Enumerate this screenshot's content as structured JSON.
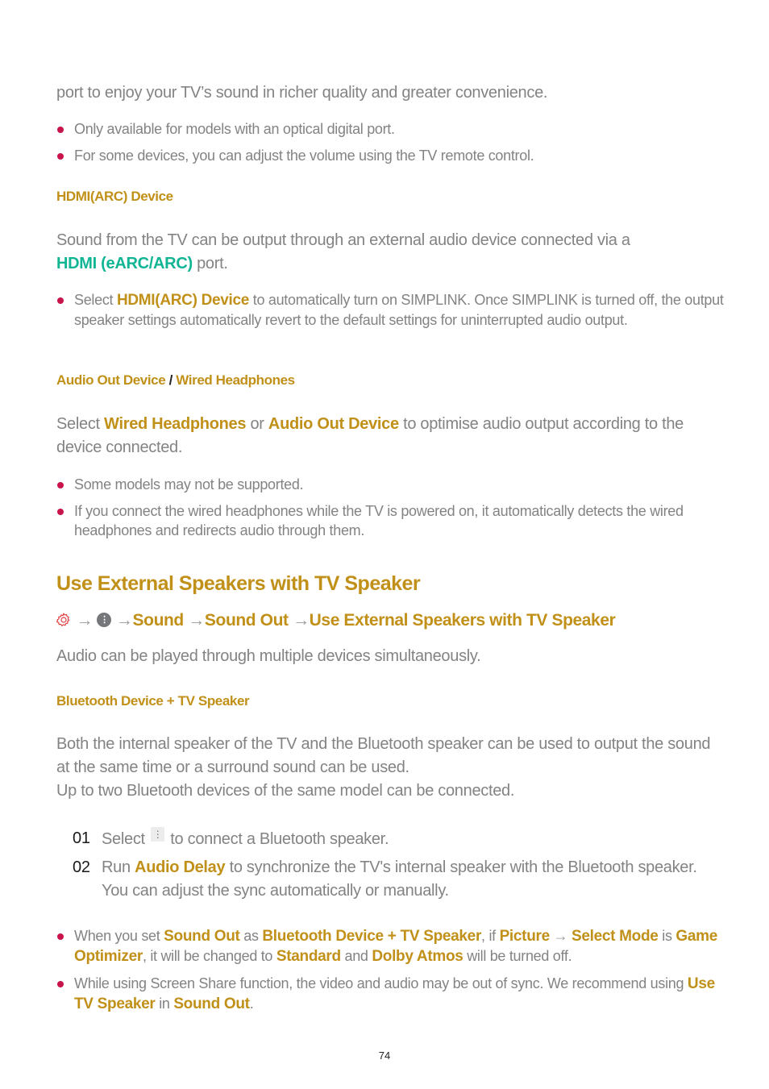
{
  "intro_line": "port to enjoy your TV’s sound in richer quality and greater convenience.",
  "optical_notes": [
    "Only available for models with an optical digital port.",
    "For some devices, you can adjust the volume using the TV remote control."
  ],
  "hdmi_section": {
    "heading": "HDMI(ARC) Device",
    "para_line1": "Sound from the TV can be output through an external audio device connected via a",
    "para_highlight": "HDMI (eARC/ARC)",
    "para_end": " port.",
    "note_prefix": "Select ",
    "note_highlight": "HDMI(ARC) Device",
    "note_rest": " to automatically turn on SIMPLINK. Once SIMPLINK is turned off, the output speaker settings automatically revert to the default settings for uninterrupted audio output."
  },
  "audio_out_section": {
    "heading_a": "Audio Out Device",
    "heading_sep": " / ",
    "heading_b": "Wired Headphones",
    "para_prefix": "Select ",
    "para_h1": "Wired Headphones",
    "para_mid": " or ",
    "para_h2": "Audio Out Device",
    "para_rest": " to optimise audio output according to the device connected.",
    "notes": [
      "Some models may not be supported.",
      "If you connect the wired headphones while the TV is powered on, it automatically detects the wired headphones and redirects audio through them."
    ]
  },
  "external_section": {
    "title": "Use External Speakers with TV Speaker",
    "breadcrumb": {
      "icons": [
        "gear-icon",
        "more-circle-icon"
      ],
      "arrow": "→",
      "items": [
        "Sound",
        "Sound Out",
        "Use External Speakers with TV Speaker"
      ]
    },
    "description": "Audio can be played through multiple devices simultaneously.",
    "subheading": "Bluetooth Device + TV Speaker",
    "para_line1": "Both the internal speaker of the TV and the Bluetooth speaker can be used to output the sound at the same time or a surround sound can be used.",
    "para_line2": "Up to two Bluetooth devices of the same model can be connected.",
    "steps": [
      {
        "num": "01",
        "prefix": "Select ",
        "icon": "menu-dots-icon",
        "rest": " to connect a Bluetooth speaker."
      },
      {
        "num": "02",
        "prefix": "Run ",
        "highlight": "Audio Delay",
        "rest": " to synchronize the TV's internal speaker with the Bluetooth speaker. You can adjust the sync automatically or manually."
      }
    ],
    "note1": {
      "t1": "When you set ",
      "h1": "Sound Out",
      "t2": " as ",
      "h2": "Bluetooth Device + TV Speaker",
      "t3": ", if ",
      "h3": "Picture",
      "arrow": " → ",
      "h4": "Select Mode",
      "t4": " is ",
      "h5": "Game Optimizer",
      "t5": ", it will be changed to ",
      "h6": "Standard",
      "t6": " and ",
      "h7": "Dolby Atmos",
      "t7": " will be turned off."
    },
    "note2": {
      "t1": "While using Screen Share function, the video and audio may be out of sync. We recommend using ",
      "h1": "Use TV Speaker",
      "t2": " in ",
      "h2": "Sound Out",
      "t3": "."
    }
  },
  "page_number": "74",
  "colors": {
    "gold": "#C19018",
    "teal": "#10B593",
    "bullet": "#C8144B",
    "body_text": "#838383"
  }
}
